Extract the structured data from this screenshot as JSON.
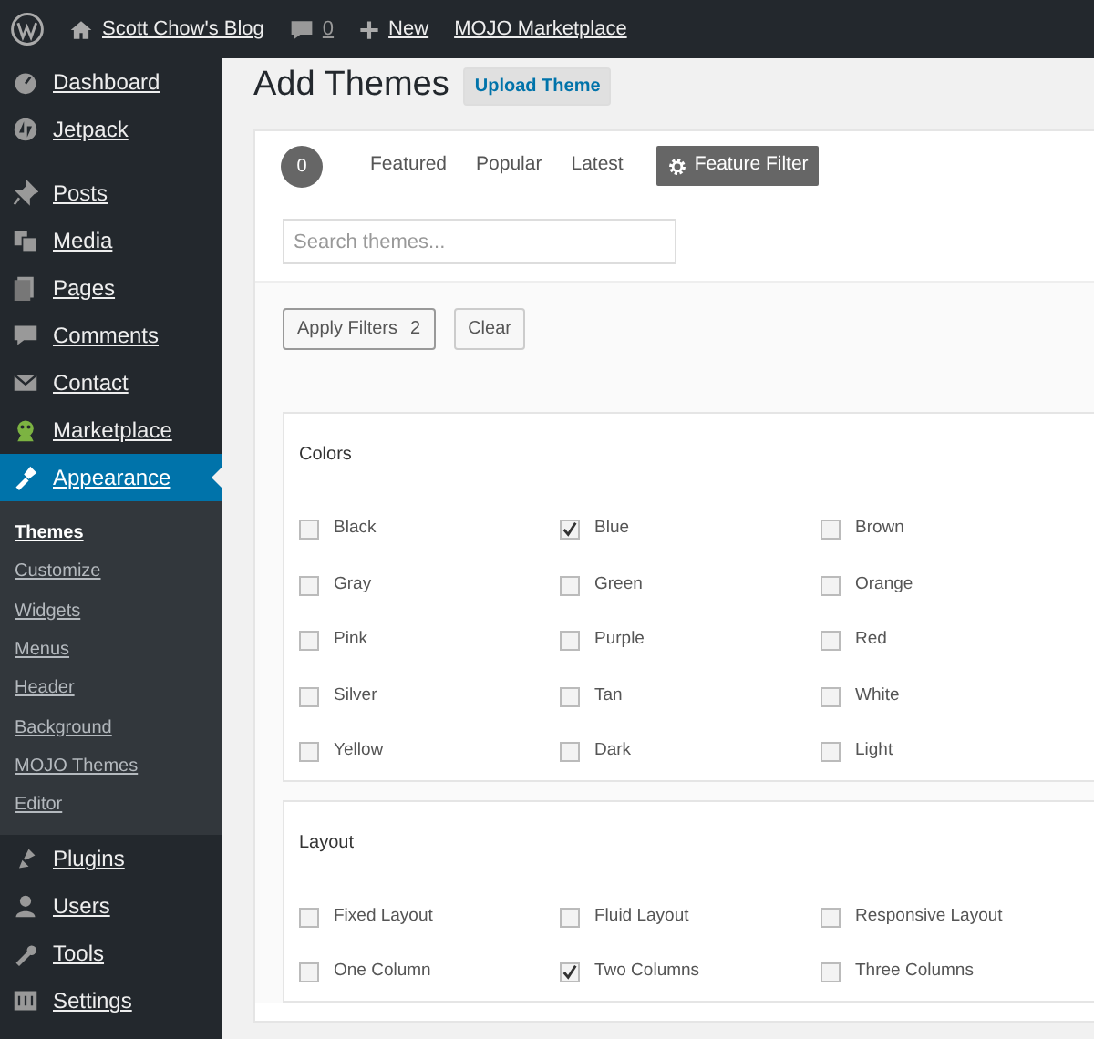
{
  "admin_bar": {
    "items": [
      {
        "kind": "logo"
      },
      {
        "kind": "site",
        "label": "Scott Chow's Blog"
      },
      {
        "kind": "comments",
        "label": "0"
      },
      {
        "kind": "new",
        "label": "New"
      },
      {
        "kind": "text",
        "label": "MOJO Marketplace"
      }
    ]
  },
  "sidebar": {
    "items": [
      {
        "label": "Dashboard",
        "selected": false
      },
      {
        "label": "Jetpack",
        "selected": false
      },
      {
        "label": "Posts",
        "selected": false
      },
      {
        "label": "Media",
        "selected": false
      },
      {
        "label": "Pages",
        "selected": false
      },
      {
        "label": "Comments",
        "selected": false
      },
      {
        "label": "Contact",
        "selected": false
      },
      {
        "label": "Marketplace",
        "selected": false
      },
      {
        "label": "Appearance",
        "selected": true,
        "children": [
          {
            "label": "Themes",
            "selected": true
          },
          {
            "label": "Customize",
            "selected": false
          },
          {
            "label": "Widgets",
            "selected": false
          },
          {
            "label": "Menus",
            "selected": false
          },
          {
            "label": "Header",
            "selected": false
          },
          {
            "label": "Background",
            "selected": false
          },
          {
            "label": "MOJO Themes",
            "selected": false
          },
          {
            "label": "Editor",
            "selected": false
          }
        ]
      },
      {
        "label": "Plugins",
        "selected": false
      },
      {
        "label": "Users",
        "selected": false
      },
      {
        "label": "Tools",
        "selected": false
      },
      {
        "label": "Settings",
        "selected": false
      }
    ]
  },
  "page": {
    "title": "Add Themes",
    "upload_button": "Upload Theme"
  },
  "filter_bar": {
    "count": "0",
    "tabs": [
      {
        "kind": "tab",
        "label": "Featured",
        "selected": false
      },
      {
        "kind": "tab",
        "label": "Popular",
        "selected": false
      },
      {
        "kind": "tab",
        "label": "Latest",
        "selected": false
      },
      {
        "kind": "filter",
        "label": "Feature Filter",
        "selected": true
      }
    ],
    "search": {
      "placeholder": "Search themes..."
    }
  },
  "filter_actions": {
    "apply": {
      "label": "Apply Filters",
      "count": "2"
    },
    "clear": "Clear"
  },
  "filter_groups": [
    {
      "title": "Colors",
      "options": [
        {
          "label": "Black",
          "checked": false
        },
        {
          "label": "Blue",
          "checked": true
        },
        {
          "label": "Brown",
          "checked": false
        },
        {
          "label": "Gray",
          "checked": false
        },
        {
          "label": "Green",
          "checked": false
        },
        {
          "label": "Orange",
          "checked": false
        },
        {
          "label": "Pink",
          "checked": false
        },
        {
          "label": "Purple",
          "checked": false
        },
        {
          "label": "Red",
          "checked": false
        },
        {
          "label": "Silver",
          "checked": false
        },
        {
          "label": "Tan",
          "checked": false
        },
        {
          "label": "White",
          "checked": false
        },
        {
          "label": "Yellow",
          "checked": false
        },
        {
          "label": "Dark",
          "checked": false
        },
        {
          "label": "Light",
          "checked": false
        }
      ]
    },
    {
      "title": "Layout",
      "options": [
        {
          "label": "Fixed Layout",
          "checked": false
        },
        {
          "label": "Fluid Layout",
          "checked": false
        },
        {
          "label": "Responsive Layout",
          "checked": false
        },
        {
          "label": "One Column",
          "checked": false
        },
        {
          "label": "Two Columns",
          "checked": true
        },
        {
          "label": "Three Columns",
          "checked": false
        }
      ]
    }
  ]
}
